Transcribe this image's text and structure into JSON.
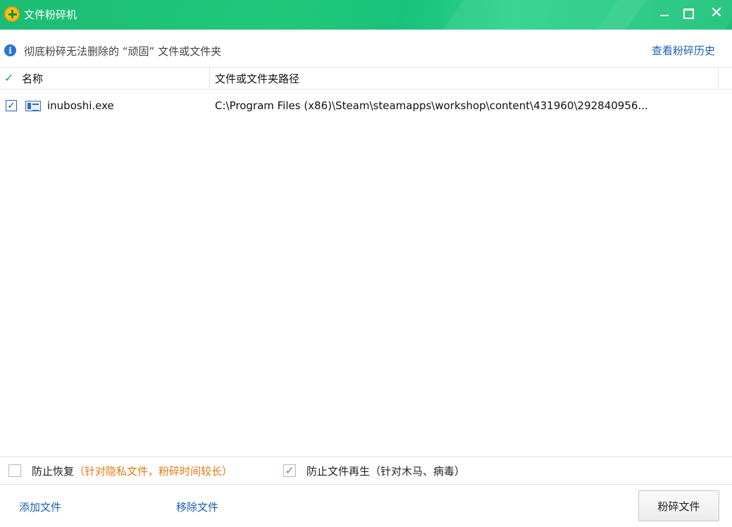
{
  "window": {
    "title": "文件粉碎机",
    "logo_icon": "plus-circle-icon",
    "minimize_icon": "minimize-icon",
    "maximize_icon": "maximize-icon",
    "close_glyph": "✕"
  },
  "info": {
    "text": "彻底粉碎无法删除的 “顽固” 文件或文件夹",
    "icon_glyph": "i",
    "history_link": "查看粉碎历史"
  },
  "table": {
    "header_check": "✓",
    "columns": {
      "name": "名称",
      "path": "文件或文件夹路径"
    },
    "rows": [
      {
        "checked": "✓",
        "name": "inuboshi.exe",
        "path": "C:\\Program Files (x86)\\Steam\\steamapps\\workshop\\content\\431960\\292840956..."
      }
    ]
  },
  "options": {
    "prevent_recovery": {
      "label": "防止恢复",
      "note": "（针对隐私文件，粉碎时间较长）",
      "check_glyph": ""
    },
    "prevent_regen": {
      "label": "防止文件再生",
      "note": "（针对木马、病毒）",
      "check_glyph": "✓"
    }
  },
  "footer": {
    "add_file": "添加文件",
    "remove_file": "移除文件",
    "shred_button": "粉碎文件"
  },
  "colors": {
    "titlebar": "#1cbc74",
    "link": "#1a5fb4",
    "note": "#e07a12",
    "check": "#2f9e4b"
  }
}
